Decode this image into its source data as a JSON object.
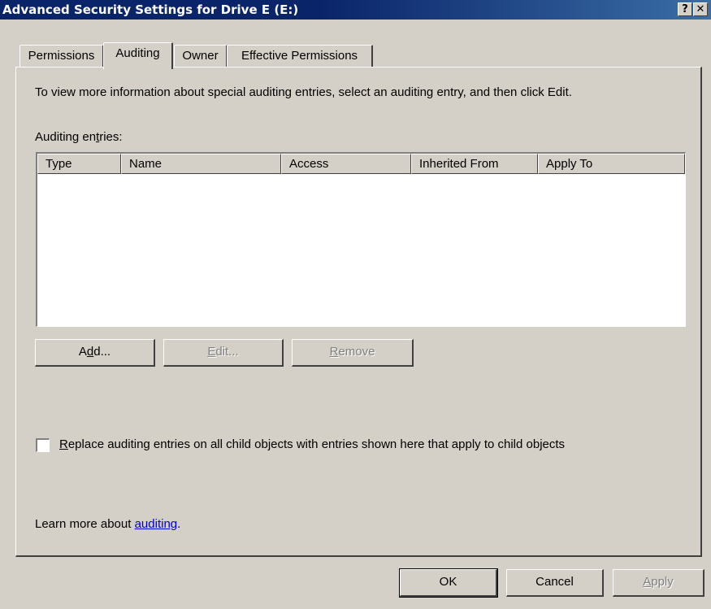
{
  "window": {
    "title": "Advanced Security Settings for Drive E (E:)",
    "help_button": "?",
    "close_button": "✕"
  },
  "tabs": [
    {
      "label": "Permissions",
      "active": false
    },
    {
      "label": "Auditing",
      "active": true
    },
    {
      "label": "Owner",
      "active": false
    },
    {
      "label": "Effective Permissions",
      "active": false
    }
  ],
  "panel": {
    "intro": "To view more information about special auditing entries, select an auditing entry, and then click Edit.",
    "entries_label_pre": "Auditing en",
    "entries_label_key": "t",
    "entries_label_post": "ries:",
    "columns": [
      "Type",
      "Name",
      "Access",
      "Inherited From",
      "Apply To"
    ],
    "rows": []
  },
  "buttons": {
    "add": {
      "pre": "A",
      "key": "d",
      "post": "d..."
    },
    "edit": {
      "pre": "",
      "key": "E",
      "post": "dit..."
    },
    "remove": {
      "pre": "",
      "key": "R",
      "post": "emove"
    }
  },
  "checkbox": {
    "pre": "",
    "key": "R",
    "post": "eplace auditing entries on all child objects with entries shown here that apply to child objects",
    "checked": false
  },
  "learn_more": {
    "prefix": "Learn more about ",
    "link": "auditing",
    "suffix": "."
  },
  "dialog_buttons": {
    "ok": "OK",
    "cancel": "Cancel",
    "apply_key": "A",
    "apply_post": "pply"
  },
  "colors": {
    "title_bar": "#0a246a",
    "face": "#d4d0c8",
    "link": "#0000cc"
  }
}
